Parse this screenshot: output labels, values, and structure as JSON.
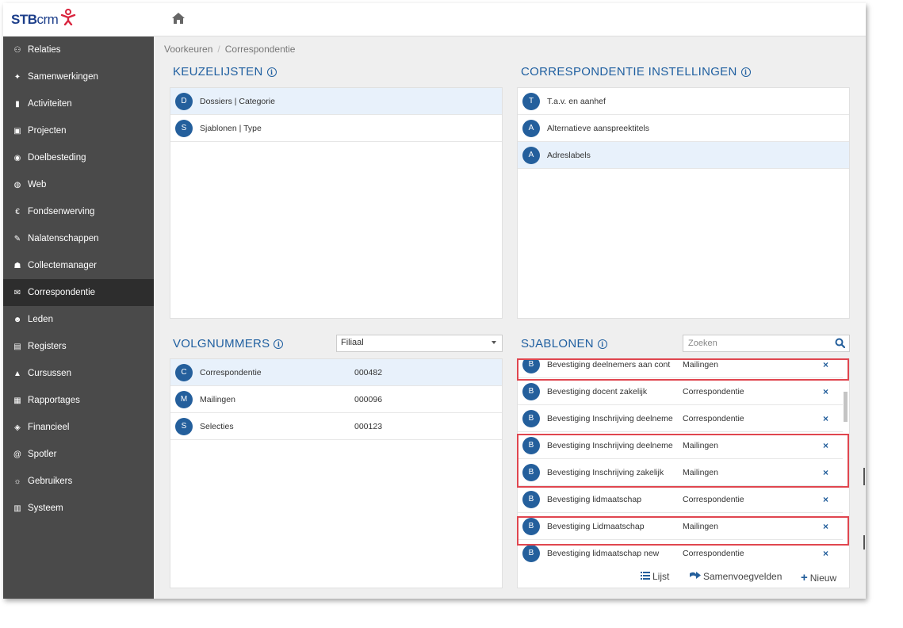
{
  "brand": {
    "name_bold": "STB",
    "name_light": "crm",
    "mark": "C8"
  },
  "sidebar": {
    "items": [
      {
        "label": "Relaties",
        "icon": "sitemap-icon"
      },
      {
        "label": "Samenwerkingen",
        "icon": "handshake-icon"
      },
      {
        "label": "Activiteiten",
        "icon": "clipboard-icon"
      },
      {
        "label": "Projecten",
        "icon": "briefcase-icon"
      },
      {
        "label": "Doelbesteding",
        "icon": "target-icon"
      },
      {
        "label": "Web",
        "icon": "globe-icon"
      },
      {
        "label": "Fondsenwerving",
        "icon": "euro-icon"
      },
      {
        "label": "Nalatenschappen",
        "icon": "signature-icon"
      },
      {
        "label": "Collectemanager",
        "icon": "users-icon"
      },
      {
        "label": "Correspondentie",
        "icon": "envelope-icon",
        "active": true
      },
      {
        "label": "Leden",
        "icon": "user-group-icon"
      },
      {
        "label": "Registers",
        "icon": "book-icon"
      },
      {
        "label": "Cursussen",
        "icon": "graduation-cap-icon"
      },
      {
        "label": "Rapportages",
        "icon": "report-icon"
      },
      {
        "label": "Financieel",
        "icon": "coins-icon"
      },
      {
        "label": "Spotler",
        "icon": "at-icon"
      },
      {
        "label": "Gebruikers",
        "icon": "users-cog-icon"
      },
      {
        "label": "Systeem",
        "icon": "server-icon"
      }
    ]
  },
  "breadcrumb": {
    "parent": "Voorkeuren",
    "separator": "/",
    "current": "Correspondentie"
  },
  "keuzelijsten": {
    "title": "KEUZELIJSTEN",
    "items": [
      {
        "badge": "D",
        "label": "Dossiers | Categorie"
      },
      {
        "badge": "S",
        "label": "Sjablonen | Type"
      }
    ]
  },
  "instellingen": {
    "title": "CORRESPONDENTIE INSTELLINGEN",
    "items": [
      {
        "badge": "T",
        "label": "T.a.v. en aanhef"
      },
      {
        "badge": "A",
        "label": "Alternatieve aanspreektitels"
      },
      {
        "badge": "A",
        "label": "Adreslabels"
      }
    ]
  },
  "volgnummers": {
    "title": "VOLGNUMMERS",
    "filter_value": "Filiaal",
    "rows": [
      {
        "badge": "C",
        "label": "Correspondentie",
        "number": "000482"
      },
      {
        "badge": "M",
        "label": "Mailingen",
        "number": "000096"
      },
      {
        "badge": "S",
        "label": "Selecties",
        "number": "000123"
      }
    ]
  },
  "sjablonen": {
    "title": "SJABLONEN",
    "search_placeholder": "Zoeken",
    "delete_glyph": "×",
    "rows": [
      {
        "badge": "B",
        "label": "Bevestiging deelnemers aan cont",
        "type": "Mailingen"
      },
      {
        "badge": "B",
        "label": "Bevestiging docent zakelijk",
        "type": "Correspondentie"
      },
      {
        "badge": "B",
        "label": "Bevestiging Inschrijving deelneme",
        "type": "Correspondentie"
      },
      {
        "badge": "B",
        "label": "Bevestiging Inschrijving deelneme",
        "type": "Mailingen"
      },
      {
        "badge": "B",
        "label": "Bevestiging Inschrijving zakelijk",
        "type": "Mailingen"
      },
      {
        "badge": "B",
        "label": "Bevestiging lidmaatschap",
        "type": "Correspondentie"
      },
      {
        "badge": "B",
        "label": "Bevestiging Lidmaatschap",
        "type": "Mailingen"
      },
      {
        "badge": "B",
        "label": "Bevestiging lidmaatschap new",
        "type": "Correspondentie"
      }
    ],
    "actions": {
      "list": "Lijst",
      "merge_fields": "Samenvoegvelden",
      "new": "Nieuw"
    }
  },
  "colors": {
    "accent": "#245f9c",
    "title": "#1f5fa0",
    "sidebar": "#4a4a4a",
    "highlight": "#e0464f"
  }
}
